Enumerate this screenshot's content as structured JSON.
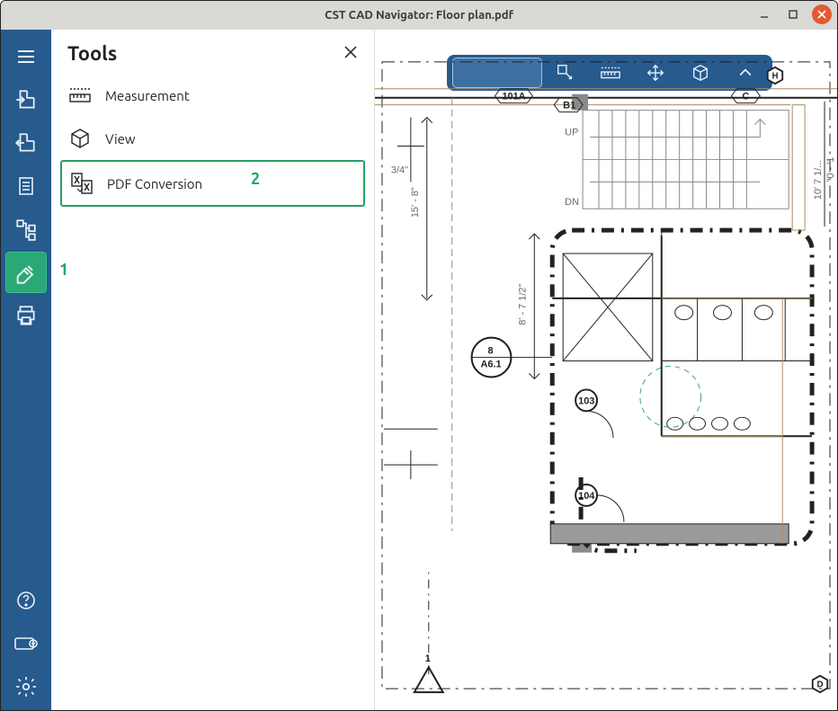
{
  "titlebar": {
    "title": "CST CAD Navigator: Floor plan.pdf"
  },
  "tools_panel": {
    "heading": "Tools",
    "items": [
      {
        "label": "Measurement"
      },
      {
        "label": "View"
      },
      {
        "label": "PDF Conversion"
      }
    ]
  },
  "annotations": {
    "sidebar_marker": "1",
    "item_marker": "2"
  },
  "plan_labels": {
    "dim_a": "3/4\"",
    "dim_b": "15' - 8\"",
    "dim_c": "8' - 7 1/2\"",
    "up": "UP",
    "dn": "DN",
    "ref_top": "8",
    "ref_bot": "A6.1",
    "tag_101a": "101A",
    "tag_b1": "B1",
    "tag_c": "C",
    "tag_h": "H",
    "tag_d": "D",
    "tag_103": "103",
    "tag_104": "104",
    "axis_1": "1",
    "dim_v1": "\"0 - '1",
    "dim_v2": "10' 7 1/..."
  },
  "colors": {
    "sidebar": "#275a8d",
    "accent": "#24a266",
    "titlebar": "#d9d9d6",
    "close": "#e25b31"
  }
}
